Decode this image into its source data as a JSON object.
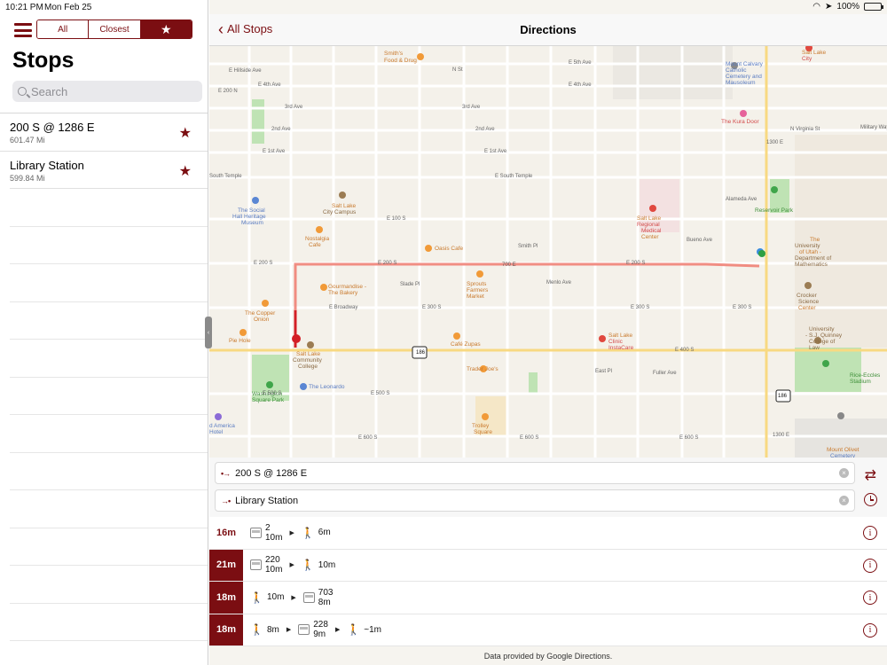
{
  "status": {
    "time": "10:21 PM",
    "date": "Mon Feb 25",
    "battery": "100%",
    "battery_level": 1.0
  },
  "sidebar": {
    "segments": [
      {
        "label": "All"
      },
      {
        "label": "Closest"
      },
      {
        "label": "★"
      }
    ],
    "title": "Stops",
    "search_placeholder": "Search",
    "stops": [
      {
        "name": "200 S @ 1286 E",
        "distance": "601.47 Mi"
      },
      {
        "name": "Library Station",
        "distance": "599.84 Mi"
      }
    ]
  },
  "nav": {
    "back_label": "All Stops",
    "title": "Directions"
  },
  "map": {
    "labels": [
      {
        "text": "Smith's"
      },
      {
        "text": "Food & Drug"
      },
      {
        "text": "Mount Calvary"
      },
      {
        "text": "Catholic"
      },
      {
        "text": "Cemetery and"
      },
      {
        "text": "Mausoleum"
      },
      {
        "text": "The Kura Door"
      },
      {
        "text": "Salt Lake"
      },
      {
        "text": "City"
      },
      {
        "text": "Military Way"
      },
      {
        "text": "The Social"
      },
      {
        "text": "Hall Heritage"
      },
      {
        "text": "Museum"
      },
      {
        "text": "Salt Lake"
      },
      {
        "text": "City Campus"
      },
      {
        "text": "Salt Lake"
      },
      {
        "text": "Regional"
      },
      {
        "text": "Medical"
      },
      {
        "text": "Center"
      },
      {
        "text": "Reservoir Park"
      },
      {
        "text": "Nostalgia"
      },
      {
        "text": "Cafe"
      },
      {
        "text": "Oasis Cafe"
      },
      {
        "text": "Smith Pl"
      },
      {
        "text": "Bueno Ave"
      },
      {
        "text": "The"
      },
      {
        "text": "University"
      },
      {
        "text": "of Utah -"
      },
      {
        "text": "Department of"
      },
      {
        "text": "Mathematics"
      },
      {
        "text": "Gourmandise -"
      },
      {
        "text": "The Bakery"
      },
      {
        "text": "Sprouts"
      },
      {
        "text": "Farmers"
      },
      {
        "text": "Market"
      },
      {
        "text": "Crocker"
      },
      {
        "text": "Science"
      },
      {
        "text": "Center"
      },
      {
        "text": "The Copper"
      },
      {
        "text": "Onion"
      },
      {
        "text": "Pie Hole"
      },
      {
        "text": "Café Zupas"
      },
      {
        "text": "Salt Lake"
      },
      {
        "text": "Clinic"
      },
      {
        "text": "InstaCare"
      },
      {
        "text": "University"
      },
      {
        "text": "- S.J. Quinney"
      },
      {
        "text": "College of"
      },
      {
        "text": "Law"
      },
      {
        "text": "Salt Lake"
      },
      {
        "text": "Community"
      },
      {
        "text": "College"
      },
      {
        "text": "Trader Joe's"
      },
      {
        "text": "Rice-Eccles"
      },
      {
        "text": "Stadium"
      },
      {
        "text": "Washington"
      },
      {
        "text": "Square Park"
      },
      {
        "text": "The Leonardo"
      },
      {
        "text": "Trolley"
      },
      {
        "text": "Square"
      },
      {
        "text": "d America"
      },
      {
        "text": "Hotel"
      },
      {
        "text": "Mount Olivet"
      },
      {
        "text": "Cemetery"
      },
      {
        "text": "E 5th Ave"
      },
      {
        "text": "E 4th Ave"
      },
      {
        "text": "E 4th Ave"
      },
      {
        "text": "3rd Ave"
      },
      {
        "text": "3rd Ave"
      },
      {
        "text": "2nd Ave"
      },
      {
        "text": "2nd Ave"
      },
      {
        "text": "E 1st Ave"
      },
      {
        "text": "E 1st Ave"
      },
      {
        "text": "E South Temple"
      },
      {
        "text": "South Temple"
      },
      {
        "text": "Alameda Ave"
      },
      {
        "text": "E 100 S"
      },
      {
        "text": "E 200 S"
      },
      {
        "text": "E 200 S"
      },
      {
        "text": "E 200 S"
      },
      {
        "text": "Slade Pl"
      },
      {
        "text": "Menlo Ave"
      },
      {
        "text": "E Broadway"
      },
      {
        "text": "E 300 S"
      },
      {
        "text": "E 300 S"
      },
      {
        "text": "E 300 S"
      },
      {
        "text": "E 400 S"
      },
      {
        "text": "East Pl"
      },
      {
        "text": "Fuller Ave"
      },
      {
        "text": "E 500 S"
      },
      {
        "text": "E 500 S"
      },
      {
        "text": "E 600 S"
      },
      {
        "text": "E 600 S"
      },
      {
        "text": "E 600 S"
      },
      {
        "text": "E Hillside Ave"
      },
      {
        "text": "E 200 N"
      },
      {
        "text": "N St"
      },
      {
        "text": "N Virginia St"
      },
      {
        "text": "1300 E"
      },
      {
        "text": "1300 E"
      },
      {
        "text": "700 E"
      },
      {
        "text": "186"
      },
      {
        "text": "186"
      }
    ]
  },
  "directions": {
    "origin": "200 S @ 1286 E",
    "destination": "Library Station",
    "routes": [
      {
        "duration": "16m",
        "selected": false,
        "steps": [
          {
            "mode": "bus",
            "line": "2",
            "time": "10m"
          },
          {
            "mode": "walk",
            "time": "6m"
          }
        ]
      },
      {
        "duration": "21m",
        "selected": true,
        "steps": [
          {
            "mode": "bus",
            "line": "220",
            "time": "10m"
          },
          {
            "mode": "walk",
            "time": "10m"
          }
        ]
      },
      {
        "duration": "18m",
        "selected": true,
        "steps": [
          {
            "mode": "walk",
            "time": "10m"
          },
          {
            "mode": "bus",
            "line": "703",
            "time": "8m"
          }
        ]
      },
      {
        "duration": "18m",
        "selected": true,
        "steps": [
          {
            "mode": "walk",
            "time": "8m"
          },
          {
            "mode": "bus",
            "line": "228",
            "time": "9m"
          },
          {
            "mode": "walk",
            "time": "~1m"
          }
        ]
      }
    ],
    "footer": "Data provided by Google Directions."
  },
  "colors": {
    "accent": "#7b0e12",
    "route_line": "#ee7a6e",
    "route_start": "#d31f27"
  }
}
